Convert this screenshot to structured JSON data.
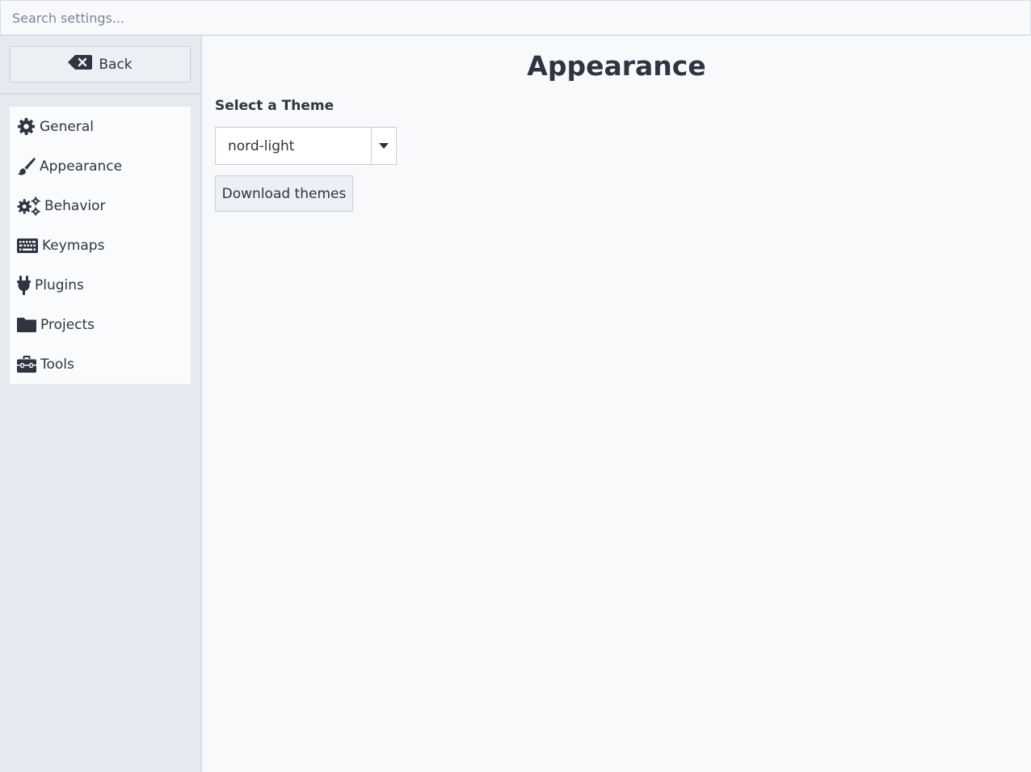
{
  "search": {
    "placeholder": "Search settings..."
  },
  "sidebar": {
    "back_label": "Back",
    "back_icon": "backspace-icon",
    "items": [
      {
        "label": "General",
        "icon": "gear-icon"
      },
      {
        "label": "Appearance",
        "icon": "paintbrush-icon"
      },
      {
        "label": "Behavior",
        "icon": "gears-icon"
      },
      {
        "label": "Keymaps",
        "icon": "keyboard-icon"
      },
      {
        "label": "Plugins",
        "icon": "plug-icon"
      },
      {
        "label": "Projects",
        "icon": "folder-icon"
      },
      {
        "label": "Tools",
        "icon": "toolbox-icon"
      }
    ]
  },
  "main": {
    "title": "Appearance",
    "theme_section_label": "Select a Theme",
    "theme_select": {
      "value": "nord-light"
    },
    "download_label": "Download themes"
  },
  "colors": {
    "text": "#2e3440",
    "sidebar_bg": "#e5e9f0",
    "main_bg": "#f8f9fb",
    "button_bg": "#eceff4",
    "border": "#c8cfda"
  }
}
